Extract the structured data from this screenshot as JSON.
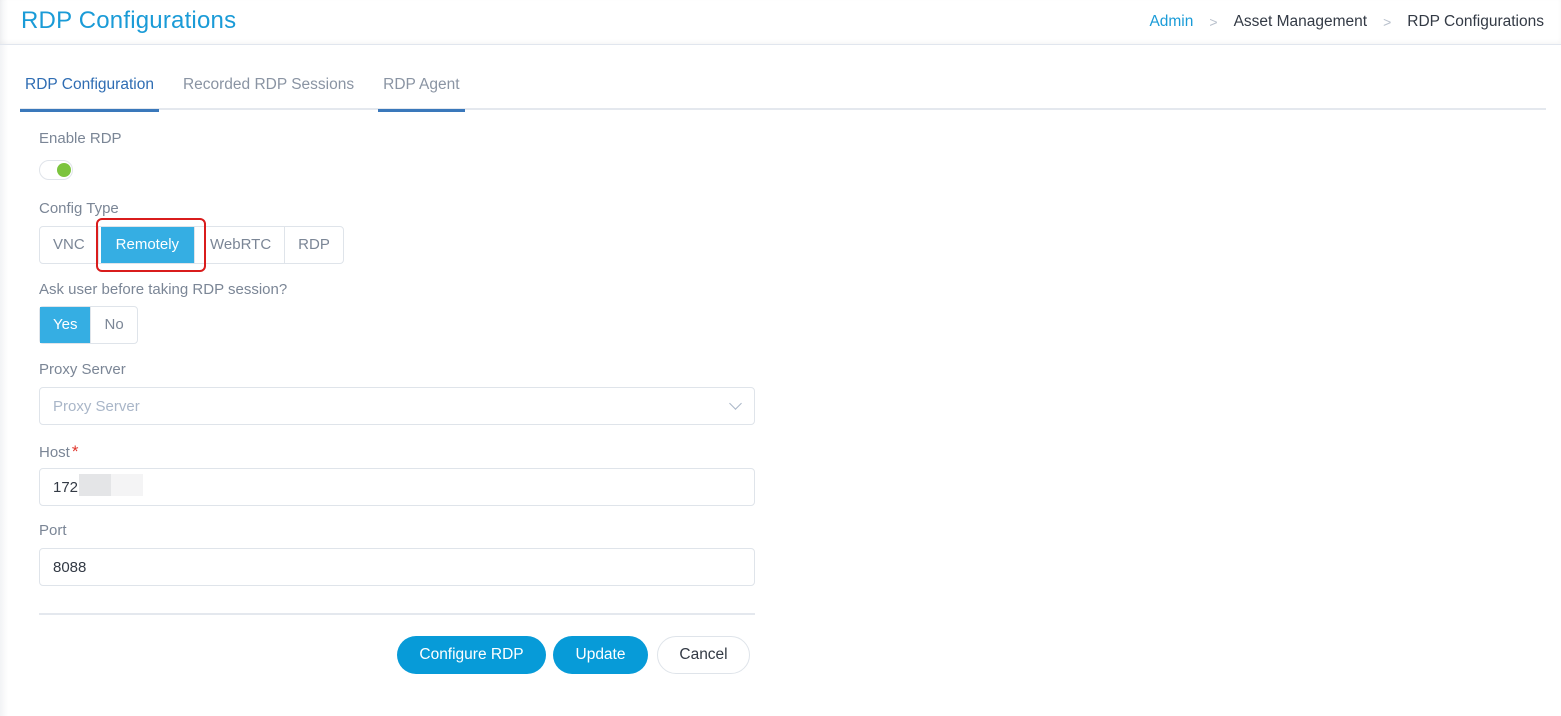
{
  "header": {
    "title": "RDP Configurations",
    "breadcrumb": [
      {
        "label": "Admin",
        "link": true
      },
      {
        "label": "Asset Management",
        "link": false
      },
      {
        "label": "RDP Configurations",
        "link": false
      }
    ],
    "separator_icon": "chevron-right-icon",
    "accent_color": "#1a9bd7"
  },
  "tabs": [
    {
      "label": "RDP Configuration",
      "active": true
    },
    {
      "label": "Recorded RDP Sessions",
      "active": false
    },
    {
      "label": "RDP Agent",
      "active": false,
      "hover_underline": true
    }
  ],
  "form": {
    "enable_rdp": {
      "label": "Enable RDP",
      "value": true
    },
    "config_type": {
      "label": "Config Type",
      "options": [
        "VNC",
        "Remotely",
        "WebRTC",
        "RDP"
      ],
      "selected": "Remotely",
      "highlighted": "Remotely"
    },
    "ask_user": {
      "label": "Ask user before taking RDP session?",
      "options": [
        "Yes",
        "No"
      ],
      "selected": "Yes"
    },
    "proxy_server": {
      "label": "Proxy Server",
      "value": "",
      "placeholder": "Proxy Server"
    },
    "host": {
      "label": "Host",
      "required_mark": "*",
      "value": "172."
    },
    "port": {
      "label": "Port",
      "value": "8088"
    }
  },
  "actions": {
    "configure_label": "Configure RDP",
    "update_label": "Update",
    "cancel_label": "Cancel"
  },
  "colors": {
    "primary": "#079bd8",
    "segment_selected": "#35aee3",
    "toggle_on": "#7cc43e",
    "highlight": "#d91c1c",
    "required": "#e0352b"
  }
}
